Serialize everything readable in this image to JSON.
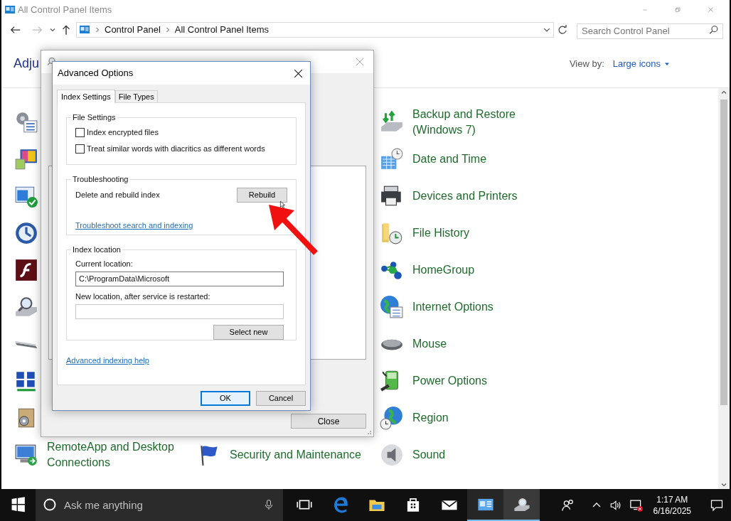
{
  "window": {
    "title": "All Control Panel Items"
  },
  "address_bar": {
    "crumbs": [
      "Control Panel",
      "All Control Panel Items"
    ]
  },
  "search": {
    "placeholder": "Search Control Panel"
  },
  "heading": "Adju",
  "view_by": {
    "label": "View by:",
    "value": "Large icons"
  },
  "right_column": [
    "Backup and Restore (Windows 7)",
    "Date and Time",
    "Devices and Printers",
    "File History",
    "HomeGroup",
    "Internet Options",
    "Mouse",
    "Power Options",
    "Region"
  ],
  "last_row": [
    "RemoteApp and Desktop Connections",
    "Security and Maintenance",
    "Sound"
  ],
  "indexing_options": {
    "close_button": "Close"
  },
  "advanced_options": {
    "title": "Advanced Options",
    "tabs": [
      {
        "label": "Index Settings",
        "selected": true
      },
      {
        "label": "File Types",
        "selected": false
      }
    ],
    "file_settings": {
      "legend": "File Settings",
      "options": [
        {
          "label": "Index encrypted files",
          "checked": false
        },
        {
          "label": "Treat similar words with diacritics as different words",
          "checked": false
        }
      ]
    },
    "troubleshooting": {
      "legend": "Troubleshooting",
      "rebuild_label": "Delete and rebuild index",
      "rebuild_button": "Rebuild",
      "link": "Troubleshoot search and indexing"
    },
    "index_location": {
      "legend": "Index location",
      "current_label": "Current location:",
      "current_value": "C:\\ProgramData\\Microsoft",
      "new_label": "New location, after service is restarted:",
      "select_button": "Select new"
    },
    "help_link": "Advanced indexing help",
    "buttons": [
      {
        "label": "OK",
        "default": true
      },
      {
        "label": "Cancel",
        "default": false
      }
    ]
  },
  "taskbar": {
    "search_placeholder": "Ask me anything",
    "apps": [
      {
        "kind": "task-view",
        "open": false
      },
      {
        "kind": "browser",
        "open": false
      },
      {
        "kind": "folder",
        "open": false
      },
      {
        "kind": "store",
        "open": false
      },
      {
        "kind": "mail",
        "open": false
      },
      {
        "kind": "control-panel",
        "open": true
      },
      {
        "kind": "indexing",
        "open": true
      }
    ],
    "clock": {
      "time": "1:17 AM",
      "date": "6/16/2025"
    }
  }
}
